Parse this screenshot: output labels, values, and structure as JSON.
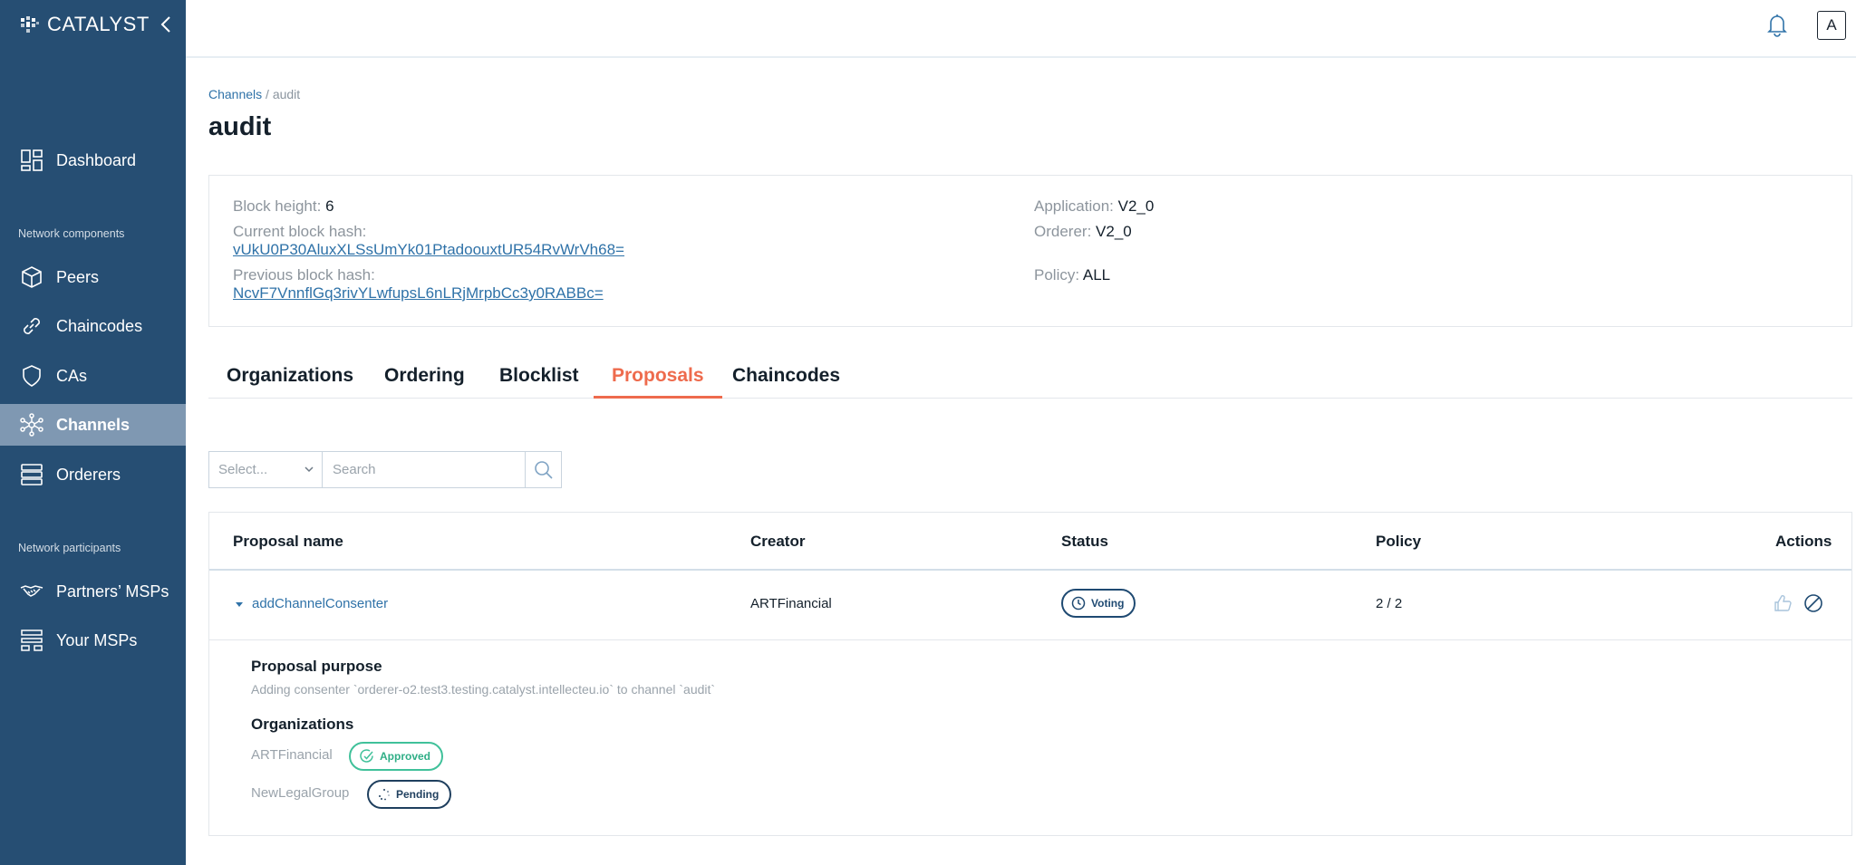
{
  "brand": {
    "name": "CATALYST"
  },
  "sidebar": {
    "items": [
      {
        "label": "Dashboard",
        "icon": "dashboard-icon"
      },
      {
        "label": "Peers",
        "icon": "cube-icon"
      },
      {
        "label": "Chaincodes",
        "icon": "link-icon"
      },
      {
        "label": "CAs",
        "icon": "shield-icon"
      },
      {
        "label": "Channels",
        "icon": "network-icon",
        "active": true
      },
      {
        "label": "Orderers",
        "icon": "server-stack-icon"
      },
      {
        "label": "Partners’ MSPs",
        "icon": "handshake-icon"
      },
      {
        "label": "Your MSPs",
        "icon": "org-chart-icon"
      }
    ],
    "section_components": "Network components",
    "section_participants": "Network participants"
  },
  "header": {
    "avatar_letter": "A"
  },
  "breadcrumb": {
    "root": "Channels",
    "separator": "/",
    "current": "audit"
  },
  "page": {
    "title": "audit"
  },
  "info": {
    "block_height_label": "Block height:",
    "block_height": "6",
    "current_hash_label": "Current block hash:",
    "current_hash": "vUkU0P30AluxXLSsUmYk01PtadoouxtUR54RvWrVh68=",
    "previous_hash_label": "Previous block hash:",
    "previous_hash": "NcvF7VnnflGq3rivYLwfupsL6nLRjMrpbCc3y0RABBc=",
    "application_label": "Application:",
    "application": "V2_0",
    "orderer_label": "Orderer:",
    "orderer": "V2_0",
    "policy_label": "Policy:",
    "policy": "ALL"
  },
  "tabs": [
    {
      "label": "Organizations"
    },
    {
      "label": "Ordering"
    },
    {
      "label": "Blocklist"
    },
    {
      "label": "Proposals",
      "active": true
    },
    {
      "label": "Chaincodes"
    }
  ],
  "filter": {
    "select_placeholder": "Select...",
    "search_placeholder": "Search"
  },
  "table": {
    "headers": {
      "name": "Proposal name",
      "creator": "Creator",
      "status": "Status",
      "policy": "Policy",
      "actions": "Actions"
    },
    "rows": [
      {
        "name": "addChannelConsenter",
        "creator": "ARTFinancial",
        "status": "Voting",
        "policy": "2 / 2",
        "purpose_title": "Proposal purpose",
        "purpose_text": "Adding consenter `orderer-o2.test3.testing.catalyst.intellecteu.io` to channel `audit`",
        "orgs_title": "Organizations",
        "orgs": [
          {
            "name": "ARTFinancial",
            "status": "Approved"
          },
          {
            "name": "NewLegalGroup",
            "status": "Pending"
          }
        ]
      }
    ]
  },
  "colors": {
    "sidebar": "#264e73",
    "active_item": "#7f98b2",
    "accent": "#ee6b4d",
    "link": "#2f72a8",
    "approved": "#40c19a"
  }
}
